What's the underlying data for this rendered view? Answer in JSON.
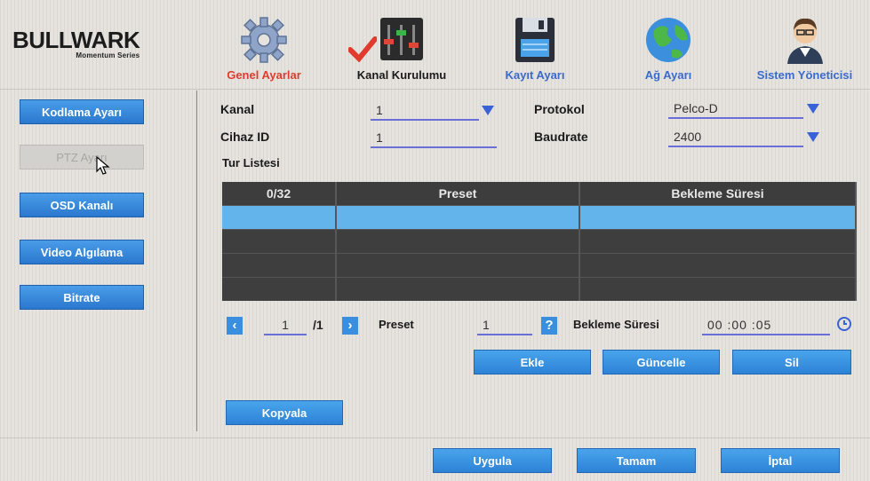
{
  "brand": {
    "name": "BULLWARK",
    "tagline": "Momentum Series"
  },
  "nav": {
    "tabs": [
      {
        "label": "Genel Ayarlar",
        "icon": "gear-icon"
      },
      {
        "label": "Kanal Kurulumu",
        "icon": "equalizer-icon"
      },
      {
        "label": "Kayıt Ayarı",
        "icon": "floppy-disk-icon"
      },
      {
        "label": "Ağ Ayarı",
        "icon": "globe-icon"
      },
      {
        "label": "Sistem Yöneticisi",
        "icon": "user-avatar-icon"
      }
    ]
  },
  "sidebar": {
    "items": [
      {
        "label": "Kodlama Ayarı"
      },
      {
        "label": "PTZ Ayarı"
      },
      {
        "label": "OSD Kanalı"
      },
      {
        "label": "Video Algılama"
      },
      {
        "label": "Bitrate"
      }
    ]
  },
  "form": {
    "kanal_label": "Kanal",
    "kanal_value": "1",
    "cihaz_label": "Cihaz ID",
    "cihaz_value": "1",
    "protokol_label": "Protokol",
    "protokol_value": "Pelco-D",
    "baudrate_label": "Baudrate",
    "baudrate_value": "2400",
    "tur_listesi_label": "Tur Listesi"
  },
  "table": {
    "headers": [
      "0/32",
      "Preset",
      "Bekleme Süresi"
    ]
  },
  "pager": {
    "current_page": "1",
    "total_pages": "/1",
    "preset_label": "Preset",
    "preset_value": "1",
    "help_label": "?",
    "bekleme_label": "Bekleme Süresi",
    "bekleme_hh": "00",
    "bekleme_mm": ":00",
    "bekleme_ss": ":05"
  },
  "actions": {
    "add": "Ekle",
    "update": "Güncelle",
    "delete": "Sil",
    "copy": "Kopyala"
  },
  "footer": {
    "apply": "Uygula",
    "ok": "Tamam",
    "cancel": "İptal"
  },
  "colors": {
    "accent_blue": "#2d82d6",
    "active_tab_red": "#e03b2d",
    "selected_row": "#62b4ea",
    "table_dark": "#3e3e3e"
  }
}
